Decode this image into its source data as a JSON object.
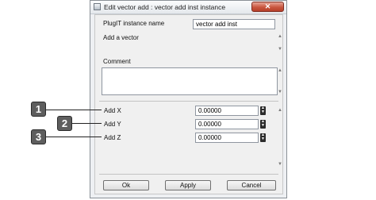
{
  "window": {
    "title": "Edit vector add : vector add inst instance",
    "close_glyph": "✕"
  },
  "form": {
    "instance_name_label": "PlugIT instance name",
    "instance_name_value": "vector add inst",
    "description": "Add a vector",
    "comment_label": "Comment",
    "comment_value": "",
    "params": [
      {
        "label": "Add X",
        "value": "0.00000"
      },
      {
        "label": "Add Y",
        "value": "0.00000"
      },
      {
        "label": "Add Z",
        "value": "0.00000"
      }
    ]
  },
  "buttons": {
    "ok": "Ok",
    "apply": "Apply",
    "cancel": "Cancel"
  },
  "callouts": [
    "1",
    "2",
    "3"
  ],
  "glyphs": {
    "up": "▲",
    "down": "▼"
  },
  "colors": {
    "close_button": "#c9573f",
    "callout_fill": "#5e5e5e"
  }
}
